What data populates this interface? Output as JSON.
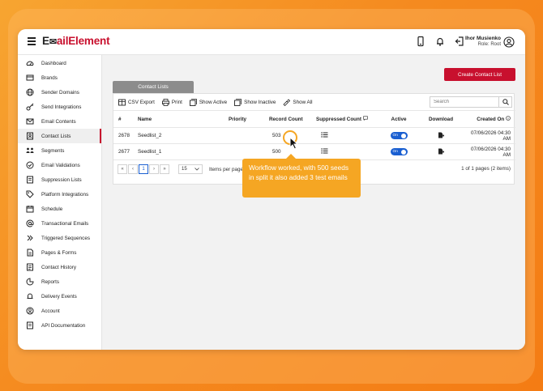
{
  "header": {
    "logo_part1": "E",
    "logo_mark": "✉",
    "logo_part2": "ailElement",
    "user_name": "Ihor Musienko",
    "user_role": "Role: Root"
  },
  "sidebar": {
    "items": [
      {
        "label": "Dashboard",
        "icon": "dashboard-icon"
      },
      {
        "label": "Brands",
        "icon": "brands-icon"
      },
      {
        "label": "Sender Domains",
        "icon": "globe-icon"
      },
      {
        "label": "Send Integrations",
        "icon": "key-icon"
      },
      {
        "label": "Email Contents",
        "icon": "mail-icon"
      },
      {
        "label": "Contact Lists",
        "icon": "contacts-icon"
      },
      {
        "label": "Segments",
        "icon": "segments-icon"
      },
      {
        "label": "Email Validations",
        "icon": "check-circle-icon"
      },
      {
        "label": "Suppression Lists",
        "icon": "suppression-icon"
      },
      {
        "label": "Platform Integrations",
        "icon": "tag-icon"
      },
      {
        "label": "Schedule",
        "icon": "calendar-icon"
      },
      {
        "label": "Transactional Emails",
        "icon": "at-icon"
      },
      {
        "label": "Triggered Sequences",
        "icon": "triggered-icon"
      },
      {
        "label": "Pages & Forms",
        "icon": "pages-icon"
      },
      {
        "label": "Contact History",
        "icon": "history-icon"
      },
      {
        "label": "Reports",
        "icon": "reports-icon"
      },
      {
        "label": "Delivery Events",
        "icon": "bell-icon"
      },
      {
        "label": "Account",
        "icon": "account-icon"
      },
      {
        "label": "API Documentation",
        "icon": "api-doc-icon"
      }
    ],
    "active_index": 5
  },
  "main": {
    "create_button": "Create Contact List",
    "tab_label": "Contact Lists",
    "toolbar": {
      "csv_export": "CSV Export",
      "print": "Print",
      "show_active": "Show Active",
      "show_inactive": "Show Inactive",
      "show_all": "Show All",
      "search_placeholder": "Search"
    },
    "table": {
      "headers": [
        "#",
        "Name",
        "Priority",
        "Record Count",
        "Suppressed Count",
        "Active",
        "Download",
        "Created On"
      ],
      "rows": [
        {
          "id": "2678",
          "name": "Seedlist_2",
          "priority": "",
          "record_count": "503",
          "active": "On",
          "created": "07/06/2026 04:30 AM"
        },
        {
          "id": "2677",
          "name": "Seedlist_1",
          "priority": "",
          "record_count": "500",
          "active": "On",
          "created": "07/06/2026 04:30 AM"
        }
      ]
    },
    "pager": {
      "first": "«",
      "prev": "‹",
      "current_page": "1",
      "next": "›",
      "last": "»",
      "page_size": "15",
      "items_per_page": "Items per page",
      "info": "1 of 1 pages (2 items)"
    }
  },
  "tooltip": {
    "text": "Workflow worked, with 500 seeds in split it also added 3 test emails"
  },
  "colors": {
    "brand_red": "#c8102e",
    "accent_blue": "#1a5fd1",
    "tooltip_orange": "#f5a623"
  }
}
